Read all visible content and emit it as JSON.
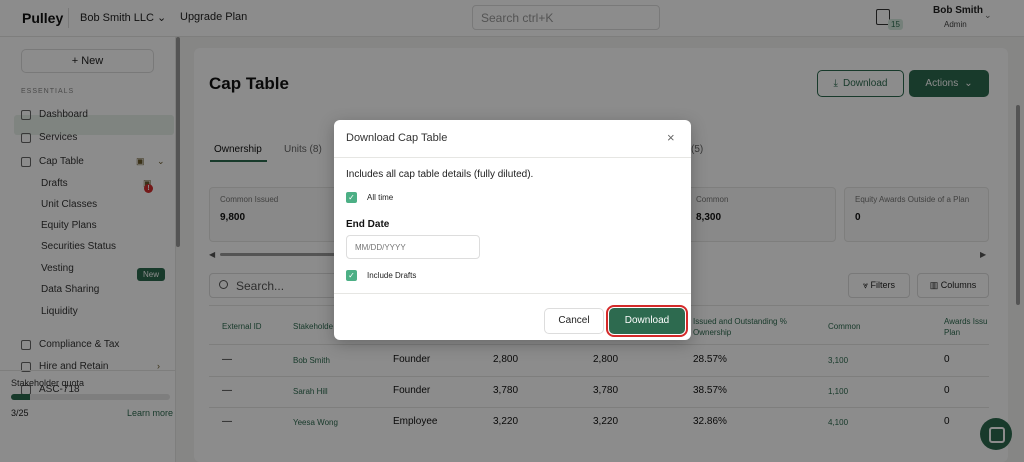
{
  "topbar": {
    "logo": "Pulley",
    "company": "Bob Smith LLC ⌄",
    "upgrade": "Upgrade Plan",
    "search_placeholder": "Search ctrl+K",
    "notification_count": "15",
    "user_name": "Bob Smith",
    "user_role": "Admin"
  },
  "sidebar": {
    "new_label": "+ New",
    "section_label": "ESSENTIALS",
    "items": [
      "Dashboard",
      "Services",
      "Cap Table",
      "Drafts",
      "Unit Classes",
      "Equity Plans",
      "Securities Status",
      "Vesting",
      "Data Sharing",
      "Liquidity",
      "Compliance & Tax",
      "Hire and Retain",
      "ASC-718"
    ],
    "new_badge": "New",
    "alert_badge": "!",
    "quota_label": "Stakeholder quota",
    "quota_count": "3/25",
    "quota_fraction": 0.12,
    "learn_more": "Learn more"
  },
  "main": {
    "title": "Cap Table",
    "download": "Download",
    "actions": "Actions",
    "tabs": [
      "Ownership",
      "Units (8)",
      "(5)"
    ],
    "cards": [
      {
        "label": "Common Issued",
        "value": "9,800"
      },
      {
        "label": "Common",
        "value": "8,300"
      },
      {
        "label": "Equity Awards Outside of a Plan",
        "value": "0"
      }
    ],
    "search": "Search...",
    "filters": "Filters",
    "columns": "Columns",
    "table": {
      "headers": [
        "External ID",
        "Stakeholde",
        "Issued and Outstanding % Ownership",
        "Common",
        "Awards Issu Plan"
      ],
      "rows": [
        [
          "—",
          "Bob Smith",
          "Founder",
          "2,800",
          "2,800",
          "28.57%",
          "3,100",
          "0"
        ],
        [
          "—",
          "Sarah Hill",
          "Founder",
          "3,780",
          "3,780",
          "38.57%",
          "1,100",
          "0"
        ],
        [
          "—",
          "Yeesa Wong",
          "Employee",
          "3,220",
          "3,220",
          "32.86%",
          "4,100",
          "0"
        ]
      ]
    }
  },
  "modal": {
    "title": "Download Cap Table",
    "close": "×",
    "description": "Includes all cap table details (fully diluted).",
    "all_time": "All time",
    "end_date_label": "End Date",
    "date_placeholder": "MM/DD/YYYY",
    "include_drafts": "Include Drafts",
    "cancel": "Cancel",
    "download": "Download"
  },
  "colors": {
    "accent": "#2d6a4f",
    "highlight": "#d42a2a"
  }
}
